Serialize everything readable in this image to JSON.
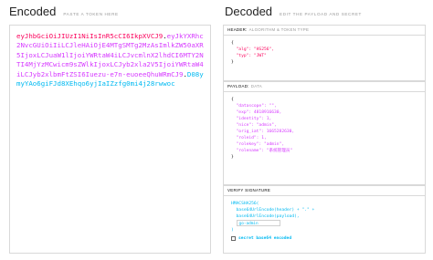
{
  "encoded": {
    "title": "Encoded",
    "subtitle": "PASTE A TOKEN HERE",
    "token_header_lines": [
      "eyJhbGciOiJIUzI1NiIsInR5cCI6IkpXVCJ9"
    ],
    "token_payload_lines": [
      "eyJkYXRhc2NvcGUiOiIiLCJleHAiOjE4MTgSMTg2M",
      "zAsImlkZW50aXR5IjoxLCJuaW1lIjoiYWRtaW4i",
      "LCJvcmlnX2lhdCI6MTY2NTI4MjYzMCwicm9sZWl",
      "kIjoxLCJyb2xla2V5IjoiYWRtaW4iLCJyb2xlbm",
      "FtZSI6Iuezu-e7n-",
      "euoeeQhuWRmCJ9"
    ],
    "token_signature_lines": [
      "D08ymyYAo6giFJd8XEhqo6yj",
      "IaIZzfg0mi4j28rwwoc"
    ],
    "dot": "."
  },
  "decoded": {
    "title": "Decoded",
    "subtitle": "EDIT THE PAYLOAD AND SECRET",
    "header_panel": {
      "label": "HEADER:",
      "label_muted": "ALGORITHM & TOKEN TYPE",
      "lines": [
        "{",
        "  \"alg\": \"HS256\",",
        "  \"typ\": \"JWT\"",
        "}"
      ]
    },
    "payload_panel": {
      "label": "PAYLOAD:",
      "label_muted": "DATA",
      "lines": [
        "{",
        "  \"datascope\": \"\",",
        "  \"exp\": 4818916630,",
        "  \"identity\": 1,",
        "  \"nice\": \"admin\",",
        "  \"orig_iat\": 1665282630,",
        "  \"roleid\": 1,",
        "  \"rolekey\": \"admin\",",
        "  \"rolename\": \"系统管理员\"",
        "}"
      ]
    },
    "verify_panel": {
      "label": "VERIFY SIGNATURE",
      "line1": "HMACSHA256(",
      "line2": "  base64UrlEncode(header) + \".\" +",
      "line3": "  base64UrlEncode(payload),",
      "secret_value": "go-admin",
      "line5": ")",
      "checkbox_label": "secret base64 encoded"
    }
  },
  "colors": {
    "header": "#fb015b",
    "payload": "#d63aff",
    "signature": "#00b9f1"
  }
}
